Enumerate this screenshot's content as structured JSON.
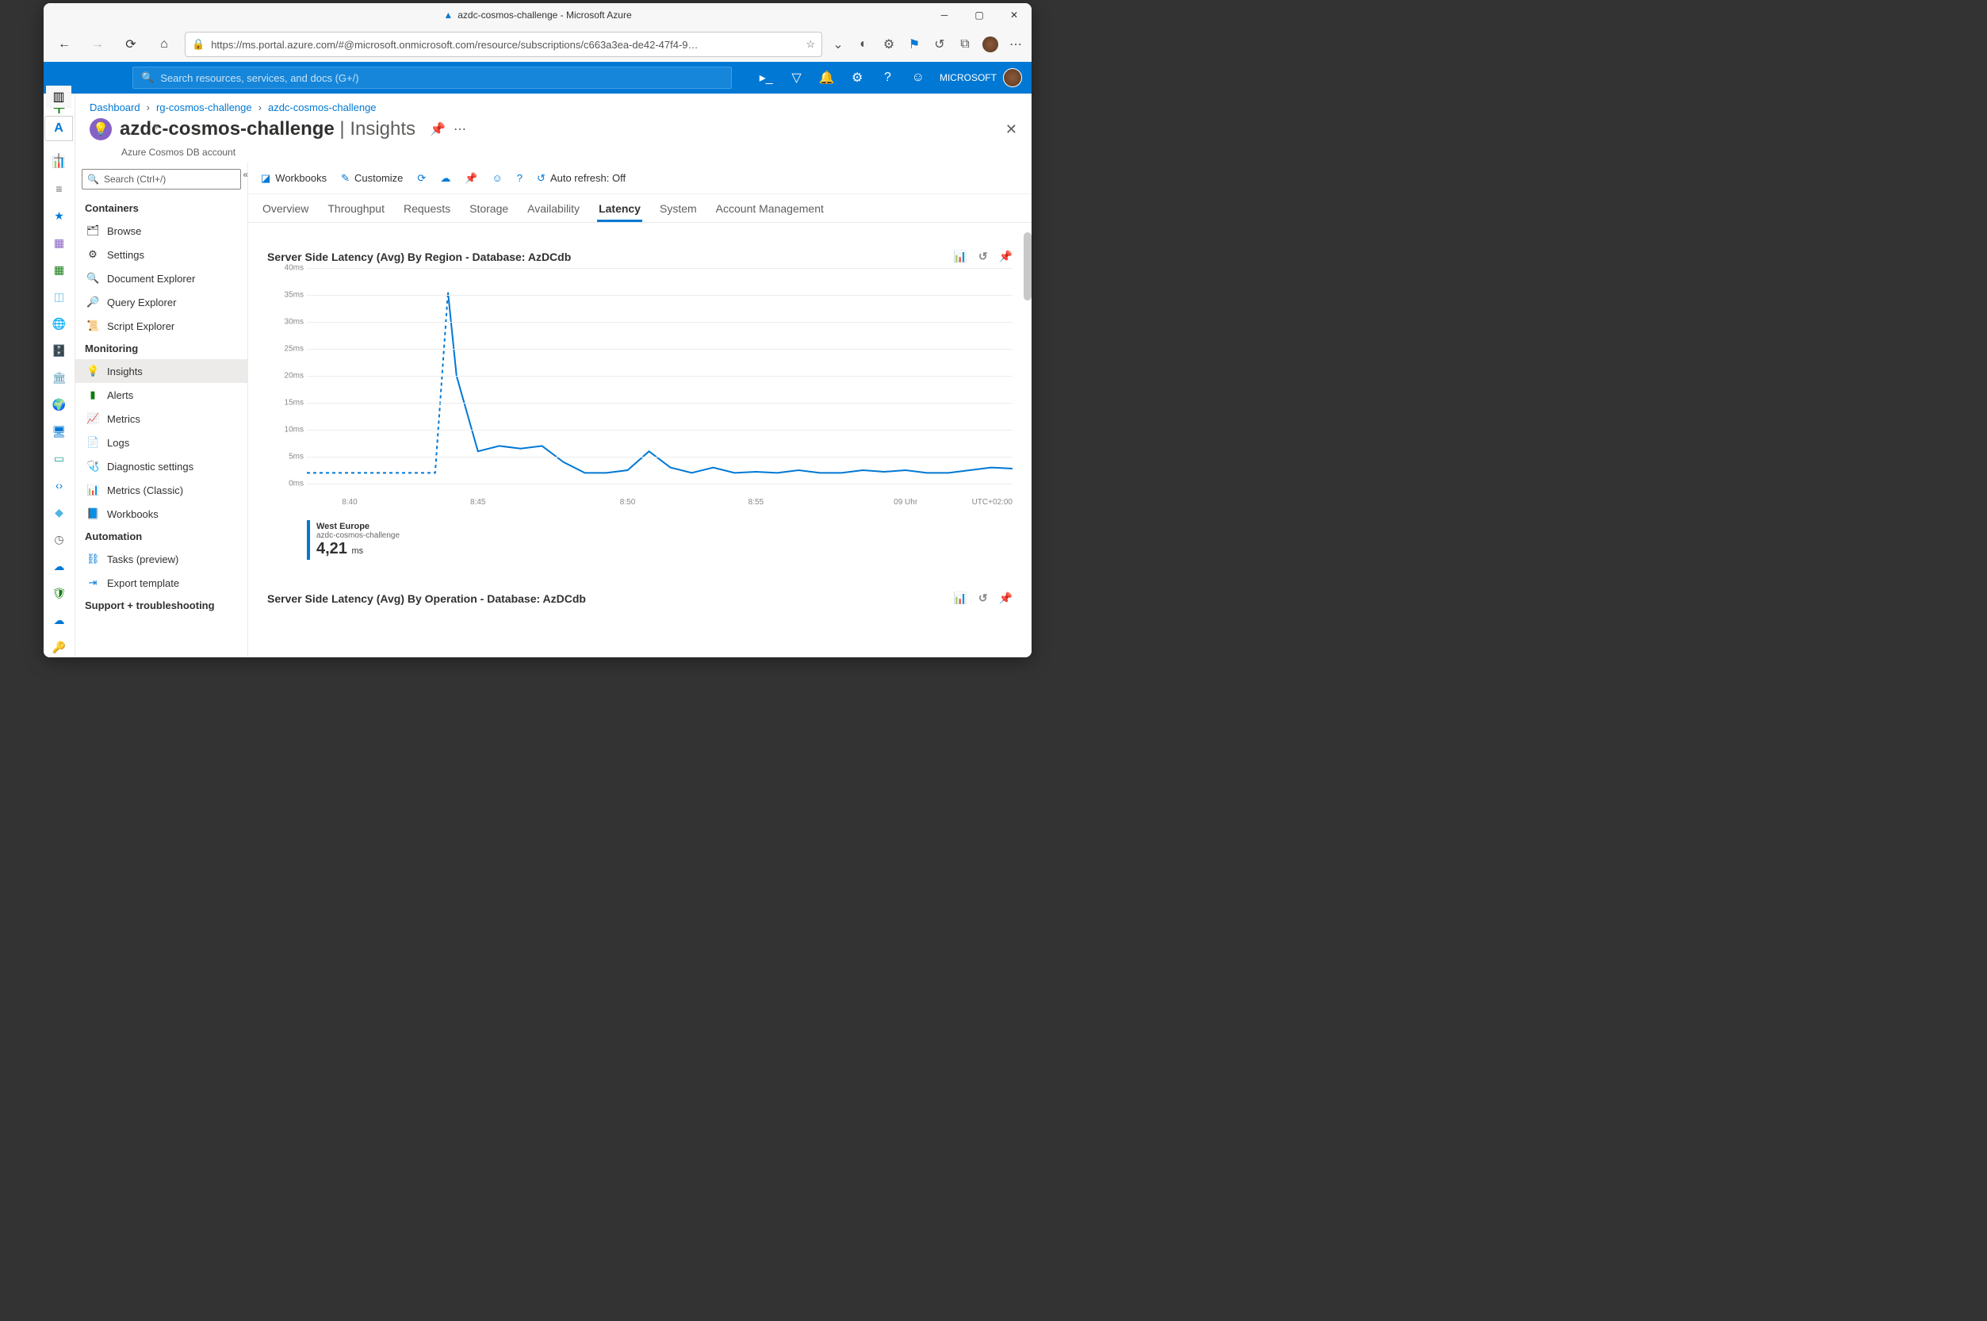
{
  "window": {
    "title": "azdc-cosmos-challenge - Microsoft Azure"
  },
  "urlbar": {
    "url": "https://ms.portal.azure.com/#@microsoft.onmicrosoft.com/resource/subscriptions/c663a3ea-de42-47f4-9…"
  },
  "header": {
    "search_placeholder": "Search resources, services, and docs (G+/)",
    "account": "MICROSOFT"
  },
  "breadcrumbs": {
    "items": [
      "Dashboard",
      "rg-cosmos-challenge",
      "azdc-cosmos-challenge"
    ]
  },
  "resource": {
    "name": "azdc-cosmos-challenge",
    "section": "Insights",
    "subtitle": "Azure Cosmos DB account"
  },
  "resnav": {
    "search_placeholder": "Search (Ctrl+/)",
    "sections": [
      {
        "title": "Containers",
        "items": [
          "Browse",
          "Settings",
          "Document Explorer",
          "Query Explorer",
          "Script Explorer"
        ]
      },
      {
        "title": "Monitoring",
        "items": [
          "Insights",
          "Alerts",
          "Metrics",
          "Logs",
          "Diagnostic settings",
          "Metrics (Classic)",
          "Workbooks"
        ]
      },
      {
        "title": "Automation",
        "items": [
          "Tasks (preview)",
          "Export template"
        ]
      },
      {
        "title": "Support + troubleshooting",
        "items": []
      }
    ],
    "selected": "Insights"
  },
  "cmdbar": {
    "workbooks": "Workbooks",
    "customize": "Customize",
    "autorefresh": "Auto refresh: Off"
  },
  "tabs": {
    "items": [
      "Overview",
      "Throughput",
      "Requests",
      "Storage",
      "Availability",
      "Latency",
      "System",
      "Account Management"
    ],
    "active": "Latency"
  },
  "chart_data": {
    "type": "line",
    "title": "Server Side Latency (Avg) By Region - Database: AzDCdb",
    "ylabel": "ms",
    "ylim": [
      0,
      40
    ],
    "yticks": [
      "0ms",
      "5ms",
      "10ms",
      "15ms",
      "20ms",
      "25ms",
      "30ms",
      "35ms",
      "40ms"
    ],
    "xticks": [
      "8:40",
      "8:45",
      "8:50",
      "8:55",
      "09 Uhr"
    ],
    "tz_label": "UTC+02:00",
    "series": [
      {
        "name": "West Europe",
        "sub": "azdc-cosmos-challenge",
        "avg": "4,21",
        "unit": "ms",
        "x": [
          0,
          1,
          2,
          3,
          4,
          5,
          6,
          6.6,
          7,
          8,
          9,
          10,
          11,
          12,
          13,
          14,
          15,
          16,
          17,
          18,
          19,
          20,
          21,
          22,
          23,
          24,
          25,
          26,
          27,
          28,
          29,
          30,
          31,
          32,
          33
        ],
        "y": [
          2,
          2,
          2,
          2,
          2,
          2,
          2,
          35.5,
          20,
          6,
          7,
          6.5,
          7,
          4,
          2,
          2,
          2.5,
          6,
          3,
          2,
          3,
          2,
          2.2,
          2,
          2.5,
          2,
          2,
          2.5,
          2.2,
          2.5,
          2,
          2,
          2.5,
          3,
          2.8
        ],
        "dashed_until_index": 7
      }
    ]
  },
  "chart2": {
    "title": "Server Side Latency (Avg) By Operation - Database: AzDCdb"
  },
  "leftstrip_icons": [
    "plus",
    "home",
    "chart",
    "list",
    "star",
    "grid-purple",
    "grid-green",
    "box",
    "globe-blue",
    "sql",
    "bank",
    "world",
    "monitor",
    "teal",
    "code",
    "gem",
    "gauge",
    "cloud-up",
    "shield",
    "cloud-down",
    "key"
  ]
}
